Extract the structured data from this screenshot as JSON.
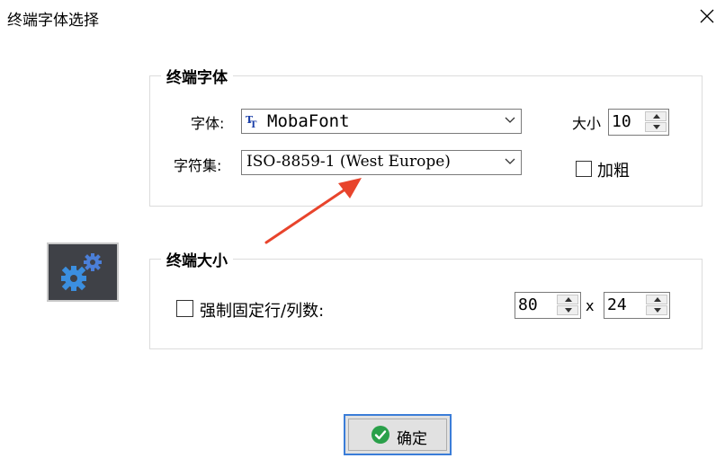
{
  "window": {
    "title": "终端字体选择"
  },
  "font_group": {
    "legend": "终端字体",
    "font_label": "字体:",
    "font_value": "MobaFont",
    "font_icon": "truetype-font-icon",
    "charset_label": "字符集:",
    "charset_value": "ISO-8859-1 (West Europe)",
    "size_label": "大小",
    "size_value": "10",
    "bold_label": "加粗",
    "bold_checked": false
  },
  "size_group": {
    "legend": "终端大小",
    "fixed_label": "强制固定行/列数:",
    "fixed_checked": false,
    "cols_value": "80",
    "separator": "x",
    "rows_value": "24"
  },
  "app_icon": "gears-icon",
  "annotation": {
    "type": "arrow",
    "color": "#e8442c"
  },
  "ok_button": {
    "label": "确定",
    "icon": "check-circle-icon",
    "accent": "#3b7dd8"
  }
}
